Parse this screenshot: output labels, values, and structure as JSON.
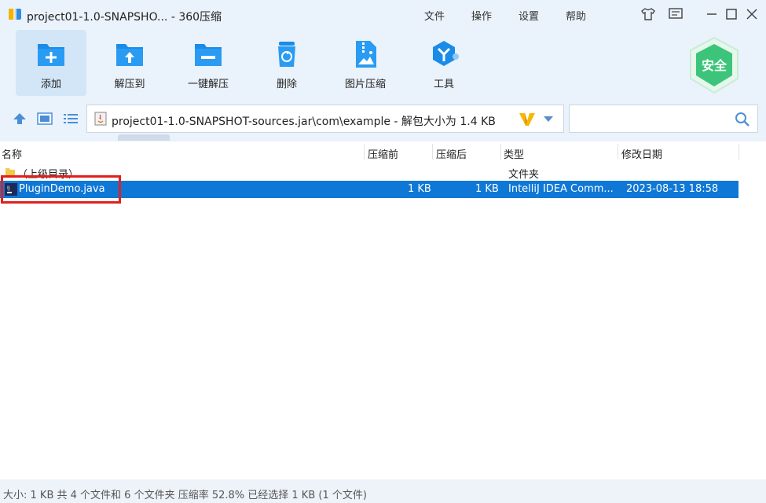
{
  "window": {
    "title": "project01-1.0-SNAPSHO... - 360压缩",
    "menus": [
      "文件",
      "操作",
      "设置",
      "帮助"
    ]
  },
  "toolbar": {
    "tools": [
      {
        "label": "添加",
        "icon": "add-icon"
      },
      {
        "label": "解压到",
        "icon": "extract-icon"
      },
      {
        "label": "一键解压",
        "icon": "one-click-extract-icon"
      },
      {
        "label": "删除",
        "icon": "delete-icon"
      },
      {
        "label": "图片压缩",
        "icon": "image-compress-icon"
      },
      {
        "label": "工具",
        "icon": "tools-icon"
      }
    ],
    "security_label": "安全"
  },
  "address": {
    "path": "project01-1.0-SNAPSHOT-sources.jar\\com\\example - 解包大小为 1.4 KB"
  },
  "list": {
    "columns": [
      "名称",
      "压缩前",
      "压缩后",
      "类型",
      "修改日期"
    ],
    "rows": [
      {
        "name": "（上级目录）",
        "before": "",
        "after": "",
        "type": "文件夹",
        "date": ""
      },
      {
        "name": "PluginDemo.java",
        "before": "1 KB",
        "after": "1 KB",
        "type": "IntelliJ IDEA Comm...",
        "date": "2023-08-13 18:58"
      }
    ]
  },
  "status": {
    "text": "大小: 1 KB 共 4 个文件和 6 个文件夹 压缩率 52.8% 已经选择 1 KB (1 个文件)"
  },
  "colors": {
    "accent": "#1a8ce8",
    "selection": "#0f78d7",
    "highlight_box": "#e0201f",
    "badge_green": "#3cc57a"
  }
}
